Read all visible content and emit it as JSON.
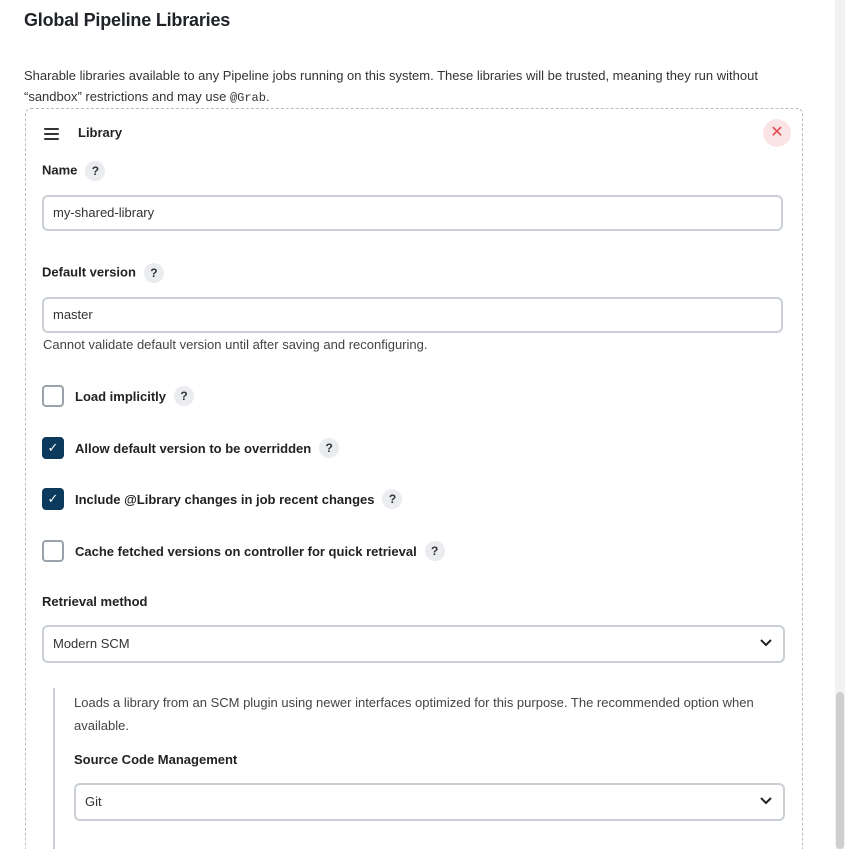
{
  "section": {
    "title": "Global Pipeline Libraries",
    "description": "Sharable libraries available to any Pipeline jobs running on this system. These libraries will be trusted, meaning they run without “sandbox” restrictions and may use",
    "description_code": "@Grab",
    "description_end": "."
  },
  "library": {
    "header": "Library",
    "close_icon": "✕",
    "name_label": "Name",
    "name_value": "my-shared-library",
    "default_version_label": "Default version",
    "default_version_value": "master",
    "default_version_hint": "Cannot validate default version until after saving and reconfiguring.",
    "help_glyph": "?",
    "checkboxes": [
      {
        "label": "Load implicitly",
        "checked": false
      },
      {
        "label": "Allow default version to be overridden",
        "checked": true
      },
      {
        "label": "Include @Library changes in job recent changes",
        "checked": true
      },
      {
        "label": "Cache fetched versions on controller for quick retrieval",
        "checked": false
      }
    ],
    "check_glyph": "✓",
    "retrieval_label": "Retrieval method",
    "retrieval_value": "Modern SCM",
    "retrieval_desc": "Loads a library from an SCM plugin using newer interfaces optimized for this purpose. The recommended option when available.",
    "scm_label": "Source Code Management",
    "scm_value": "Git",
    "chevron_glyph": "⌄"
  },
  "colors": {
    "checkbox_checked": "#0b3a5c",
    "close_bg": "#fbe4e6",
    "close_fg": "#e5484d"
  }
}
